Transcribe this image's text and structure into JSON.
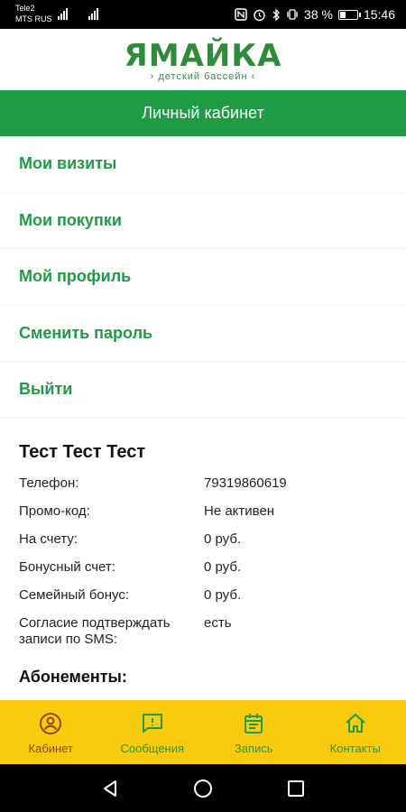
{
  "status_bar": {
    "carrier1": "Tele2",
    "carrier2": "MTS RUS",
    "battery_text": "38 %",
    "time": "15:46",
    "battery_level": 0.38
  },
  "logo": {
    "title": "ЯМАЙКА",
    "subtitle": "› детский бассейн ‹"
  },
  "header": {
    "title": "Личный кабинет"
  },
  "menu": {
    "items": [
      {
        "label": "Мои визиты"
      },
      {
        "label": "Мои покупки"
      },
      {
        "label": "Мой профиль"
      },
      {
        "label": "Сменить пароль"
      },
      {
        "label": "Выйти"
      }
    ]
  },
  "profile": {
    "name": "Тест Тест Тест",
    "rows": [
      {
        "label": "Телефон:",
        "value": "79319860619"
      },
      {
        "label": "Промо-код:",
        "value": "Не активен"
      },
      {
        "label": "На счету:",
        "value": "0 руб."
      },
      {
        "label": "Бонусный счет:",
        "value": "0 руб."
      },
      {
        "label": "Семейный бонус:",
        "value": "0 руб."
      },
      {
        "label": "Согласие подтверждать записи по SMS:",
        "value": "есть"
      }
    ],
    "subscriptions_title": "Абонементы:"
  },
  "bottom_nav": {
    "items": [
      {
        "label": "Кабинет",
        "icon": "account-icon",
        "active": true
      },
      {
        "label": "Сообщения",
        "icon": "message-icon",
        "active": false
      },
      {
        "label": "Запись",
        "icon": "calendar-icon",
        "active": false
      },
      {
        "label": "Контакты",
        "icon": "home-icon",
        "active": false
      }
    ]
  },
  "colors": {
    "brand_green": "#1f9a45",
    "nav_yellow": "#f8cb0f",
    "active_brown": "#8a4a10"
  }
}
